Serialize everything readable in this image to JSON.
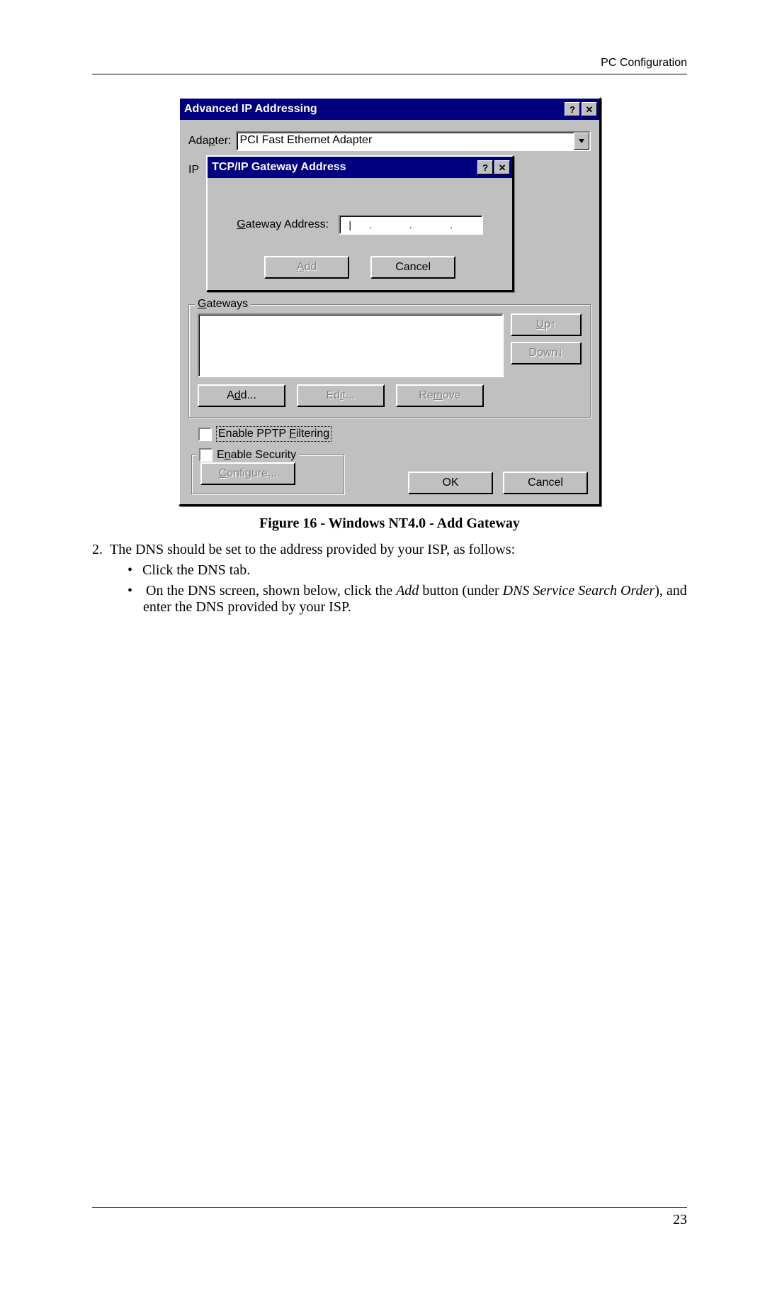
{
  "page": {
    "header": "PC Configuration",
    "number": "23"
  },
  "outerDialog": {
    "title": "Advanced IP Addressing",
    "adapterLabel": "Adapter:",
    "adapterValue": "PCI Fast Ethernet Adapter",
    "ipPrefix": "IP",
    "gateways": {
      "legend": "Gateways",
      "up": "Up↑",
      "down": "Down↓",
      "add": "Add...",
      "edit": "Edit...",
      "remove": "Remove"
    },
    "pptp": "Enable PPTP Filtering",
    "security": {
      "legend": "Enable Security",
      "configure": "Configure..."
    },
    "ok": "OK",
    "cancel": "Cancel"
  },
  "innerDialog": {
    "title": "TCP/IP Gateway Address",
    "label": "Gateway Address:",
    "add": "Add",
    "cancel": "Cancel"
  },
  "caption": "Figure 16 - Windows NT4.0 - Add Gateway",
  "text": {
    "num": "2.",
    "line1": "The DNS should be set to the address provided by your ISP, as follows:",
    "b1": "Click the DNS tab.",
    "b2a": "On the DNS screen, shown below, click the ",
    "b2_add": "Add",
    "b2b": " button (under ",
    "b2_dns": "DNS Service Search Order",
    "b2c": "), and enter the DNS provided by your ISP."
  }
}
